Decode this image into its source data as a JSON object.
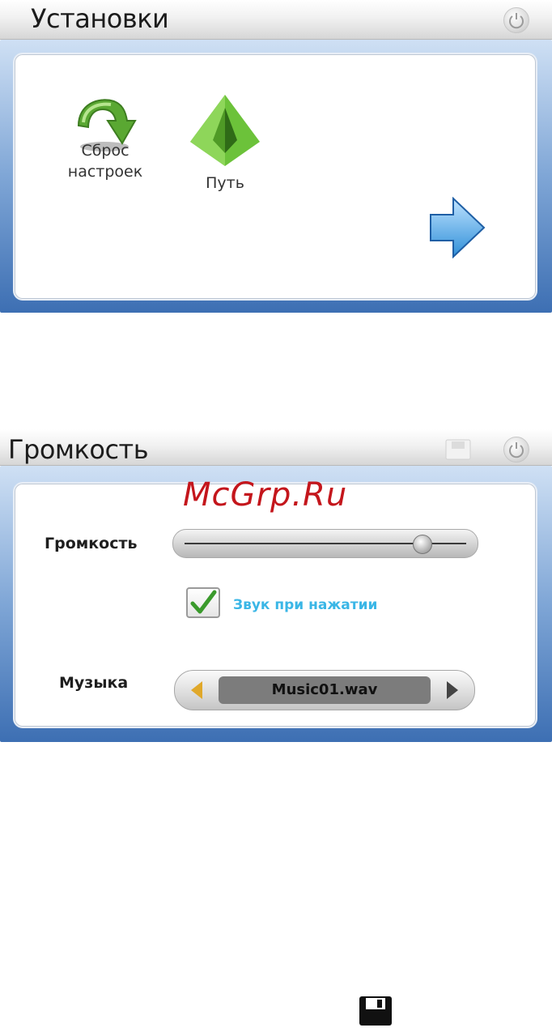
{
  "screen1": {
    "title": "Установки",
    "icons": {
      "power": "power-icon",
      "reset": "reset-arrow-icon",
      "path": "pyramid-icon",
      "next": "next-arrow-icon"
    },
    "tools": [
      {
        "label_line1": "Сброс",
        "label_line2": "настроек"
      },
      {
        "label": "Путь"
      }
    ]
  },
  "screen2": {
    "title": "Громкость",
    "icons": {
      "save": "save-icon",
      "power": "power-icon",
      "check": "checkmark-icon"
    },
    "volume": {
      "label": "Громкость",
      "level": 0.87
    },
    "click_sound": {
      "label": "Звук при нажатии",
      "checked": true
    },
    "music": {
      "label": "Музыка",
      "value": "Music01.wav"
    }
  },
  "watermark": "McGrp.Ru",
  "footer_icon": "floppy-disk-icon",
  "colors": {
    "frame_blue": "#3d6fb3",
    "check_label": "#3ab6e6",
    "watermark": "#c4161c",
    "left_arrow": "#e0a82a",
    "icon_green": "#5aa832",
    "arrow_blue": "#2f8fd8"
  }
}
